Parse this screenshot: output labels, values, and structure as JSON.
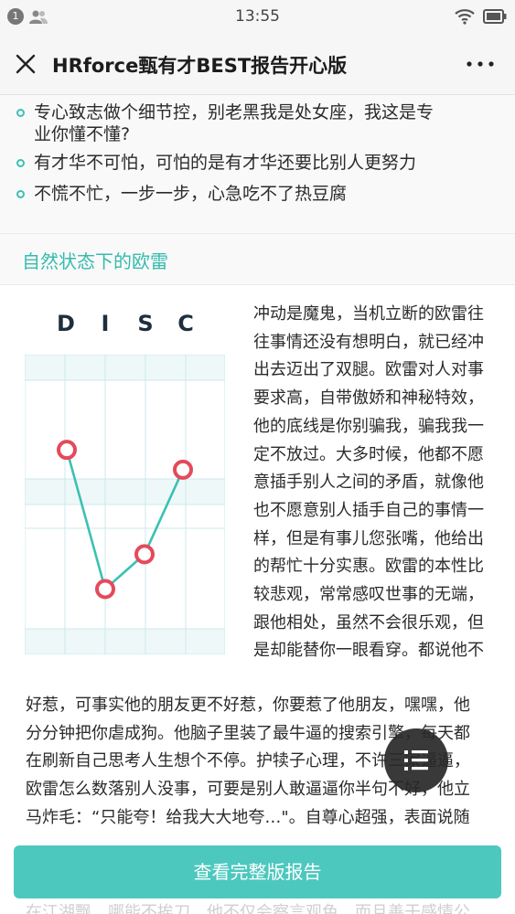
{
  "status_bar": {
    "notification_count": "1",
    "time": "13:55"
  },
  "title_bar": {
    "title": "HRforce甄有才BEST报告开心版"
  },
  "bullets": [
    "专心致志做个细节控，别老黑我是处女座，我这是专",
    "业你懂不懂?",
    "有才华不可怕，可怕的是有才华还要比别人更努力",
    "不慌不忙，一步一步，心急吃不了热豆腐"
  ],
  "section": {
    "heading": "自然状态下的欧雷"
  },
  "chart_data": {
    "type": "line",
    "categories": [
      "D",
      "I",
      "S",
      "C"
    ],
    "values": [
      72,
      16,
      30,
      64
    ],
    "ylim": [
      0,
      100
    ],
    "grid": true,
    "colors": {
      "line": "#3cc0b4",
      "marker": "#e44a5c",
      "grid": "#cde9ec",
      "band": "#eef8f9"
    }
  },
  "article": {
    "right_lines": [
      "冲动是魔鬼，当机立断的欧雷往",
      "往事情还没有想明白，就已经冲",
      "出去迈出了双腿。欧雷对人对事",
      "要求高，自带傲娇和神秘特效，",
      "他的底线是你别骗我，骗我我一",
      "定不放过。大多时候，他都不愿",
      "意插手别人之间的矛盾，就像他",
      "也不愿意别人插手自己的事情一",
      "样，但是有事儿您张嘴，他给出",
      "的帮忙十分实惠。欧雷的本性比",
      "较悲观，常常感叹世事的无端，",
      "跟他相处，虽然不会很乐观，但",
      "是却能替你一眼看穿。都说他不"
    ],
    "full_lines": [
      "好惹，可事实他的朋友更不好惹，你要惹了他朋友，嘿嘿，他",
      "分分钟把你虐成狗。他脑子里装了最牛逼的搜索引擎，每天都",
      "在刷新自己思考人生想个不停。护犊子心理，不许三家逼逼，",
      "欧雷怎么数落别人没事，可要是别人敢逼逼你半句不好，他立",
      "马炸毛：“只能夸！给我大大地夸…\"。自尊心超强，表面说随"
    ],
    "clipped_line": "在江湖飘，哪能不挨刀，他不仅会察言观色，而且善于感情公"
  },
  "cta": {
    "label": "查看完整版报告"
  }
}
